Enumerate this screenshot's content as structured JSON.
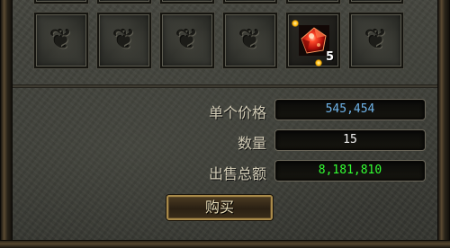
{
  "slots": {
    "top_row_count": 6,
    "main_row": [
      {
        "type": "empty",
        "icon": "dragon-emblem-icon"
      },
      {
        "type": "empty",
        "icon": "dragon-emblem-icon"
      },
      {
        "type": "empty",
        "icon": "dragon-emblem-icon"
      },
      {
        "type": "empty",
        "icon": "dragon-emblem-icon"
      },
      {
        "type": "item",
        "icon": "red-gem-icon",
        "count": "5"
      },
      {
        "type": "empty",
        "icon": "dragon-emblem-icon"
      }
    ]
  },
  "info": {
    "unit_price_label": "单个价格",
    "unit_price_value": "545,454",
    "quantity_label": "数量",
    "quantity_value": "15",
    "total_label": "出售总额",
    "total_value": "8,181,810"
  },
  "buy_button_label": "购买",
  "colors": {
    "unit_price": "#6fb4ea",
    "quantity": "#f2f2f2",
    "total": "#32ff32",
    "label": "#d2ccb6",
    "button_border": "#a88a4a"
  }
}
